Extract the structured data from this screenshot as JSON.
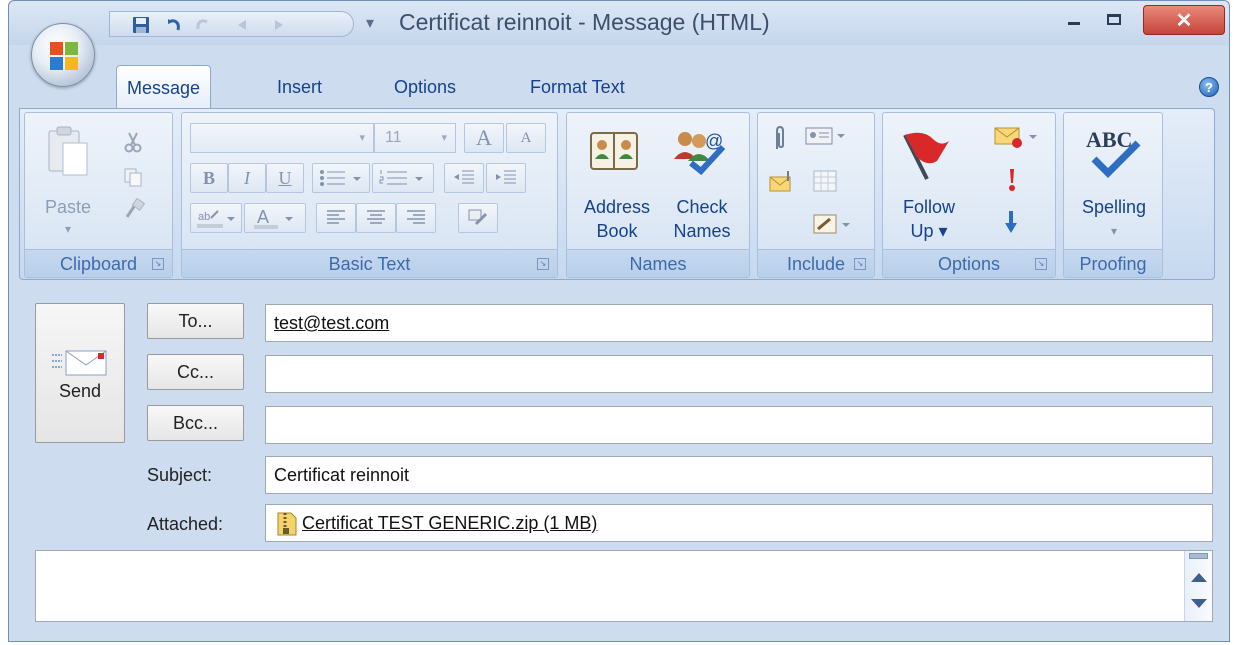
{
  "window": {
    "title": "Certificat reinnoit - Message (HTML)",
    "close_symbol": "✕"
  },
  "tabs": [
    {
      "label": "Message",
      "active": true
    },
    {
      "label": "Insert",
      "active": false
    },
    {
      "label": "Options",
      "active": false
    },
    {
      "label": "Format Text",
      "active": false
    }
  ],
  "help_symbol": "?",
  "ribbon": {
    "clipboard": {
      "label": "Clipboard",
      "paste": "Paste"
    },
    "basic_text": {
      "label": "Basic Text",
      "font_size": "11",
      "bold": "B",
      "italic": "I",
      "underline": "U",
      "grow": "A",
      "shrink": "A"
    },
    "names": {
      "label": "Names",
      "address_book_1": "Address",
      "address_book_2": "Book",
      "check_names_1": "Check",
      "check_names_2": "Names"
    },
    "include": {
      "label": "Include"
    },
    "options": {
      "label": "Options",
      "follow_up_1": "Follow",
      "follow_up_2": "Up ▾"
    },
    "proofing": {
      "label": "Proofing",
      "spelling": "Spelling",
      "abc": "ABC"
    }
  },
  "message": {
    "send_label": "Send",
    "to_button": "To...",
    "cc_button": "Cc...",
    "bcc_button": "Bcc...",
    "to_value": "test@test.com",
    "cc_value": "",
    "bcc_value": "",
    "subject_label": "Subject:",
    "subject_value": "Certificat reinnoit",
    "attached_label": "Attached:",
    "attachment": "Certificat TEST GENERIC.zip (1 MB)"
  },
  "colors": {
    "accent": "#15428b",
    "close_button": "#c6433a",
    "ribbon_bg": "#d3e1f3"
  }
}
